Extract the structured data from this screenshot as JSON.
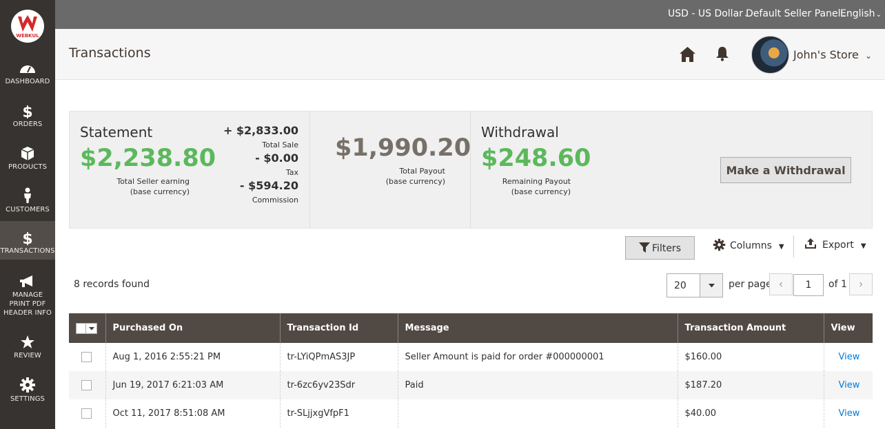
{
  "brand": {
    "logo_text": "WEBKUL"
  },
  "sidebar": {
    "items": [
      {
        "label": "DASHBOARD",
        "icon": "dashboard-icon"
      },
      {
        "label": "ORDERS",
        "icon": "dollar-icon"
      },
      {
        "label": "PRODUCTS",
        "icon": "box-icon"
      },
      {
        "label": "CUSTOMERS",
        "icon": "person-icon"
      },
      {
        "label": "TRANSACTIONS",
        "icon": "dollar-icon",
        "active": true
      },
      {
        "label": "MANAGE PRINT PDF HEADER INFO",
        "icon": "megaphone-icon"
      },
      {
        "label": "REVIEW",
        "icon": "star-icon"
      },
      {
        "label": "SETTINGS",
        "icon": "gear-icon"
      }
    ]
  },
  "topbar": {
    "currency": "USD - US Dollar",
    "panel": "Default Seller Panel",
    "language": "English"
  },
  "header": {
    "title": "Transactions",
    "store_name": "John's Store"
  },
  "statement": {
    "title": "Statement",
    "earning": "$2,238.80",
    "earning_label_1": "Total Seller earning",
    "earning_label_2": "(base currency)",
    "total_sale": "+ $2,833.00",
    "total_sale_label": "Total Sale",
    "tax": "- $0.00",
    "tax_label": "Tax",
    "commission": "- $594.20",
    "commission_label": "Commission",
    "payout": "$1,990.20",
    "payout_label_1": "Total Payout",
    "payout_label_2": "(base currency)",
    "withdrawal_title": "Withdrawal",
    "remaining": "$248.60",
    "remaining_label_1": "Remaining Payout",
    "remaining_label_2": "(base currency)",
    "withdraw_button": "Make a Withdrawal"
  },
  "toolbar": {
    "filters": "Filters",
    "columns": "Columns",
    "export": "Export"
  },
  "listing": {
    "records": "8 records found",
    "per_page_value": "20",
    "per_page_label": "per page",
    "page": "1",
    "of_pages": "of 1"
  },
  "table": {
    "headers": [
      "Purchased On",
      "Transaction Id",
      "Message",
      "Transaction Amount",
      "View"
    ],
    "rows": [
      {
        "purchased_on": "Aug 1, 2016 2:55:21 PM",
        "transaction_id": "tr-LYiQPmAS3JP",
        "message": "Seller Amount is paid for order #000000001",
        "amount": "$160.00",
        "view": "View"
      },
      {
        "purchased_on": "Jun 19, 2017 6:21:03 AM",
        "transaction_id": "tr-6zc6yv23Sdr",
        "message": "Paid",
        "amount": "$187.20",
        "view": "View"
      },
      {
        "purchased_on": "Oct 11, 2017 8:51:08 AM",
        "transaction_id": "tr-SLjjxgVfpF1",
        "message": "",
        "amount": "$40.00",
        "view": "View"
      }
    ]
  },
  "colors": {
    "sidebar_bg": "#373330",
    "header_bg": "#514943",
    "green": "#5cb85c",
    "link": "#007bdb"
  }
}
